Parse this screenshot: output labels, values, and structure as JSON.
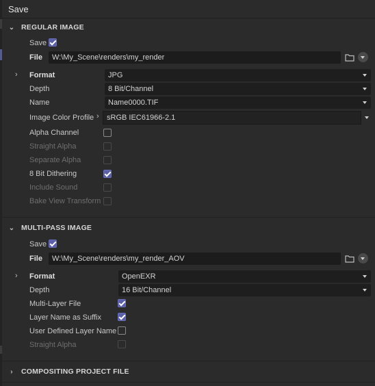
{
  "window": {
    "title": "Save"
  },
  "regular_image": {
    "header": "REGULAR IMAGE",
    "save_label": "Save",
    "save_checked": true,
    "file_label": "File",
    "file_value": "W:\\My_Scene\\renders\\my_render",
    "format_label": "Format",
    "format_value": "JPG",
    "depth_label": "Depth",
    "depth_value": "8 Bit/Channel",
    "name_label": "Name",
    "name_value": "Name0000.TIF",
    "profile_label": "Image Color Profile",
    "profile_value": "sRGB IEC61966-2.1",
    "options": [
      {
        "label": "Alpha Channel",
        "checked": false,
        "enabled": true
      },
      {
        "label": "Straight Alpha",
        "checked": false,
        "enabled": false
      },
      {
        "label": "Separate Alpha",
        "checked": false,
        "enabled": false
      },
      {
        "label": "8 Bit Dithering",
        "checked": true,
        "enabled": true
      },
      {
        "label": "Include Sound",
        "checked": false,
        "enabled": false
      },
      {
        "label": "Bake View Transform",
        "checked": false,
        "enabled": false
      }
    ]
  },
  "multi_pass": {
    "header": "MULTI-PASS IMAGE",
    "save_label": "Save",
    "save_checked": true,
    "file_label": "File",
    "file_value": "W:\\My_Scene\\renders\\my_render_AOV",
    "format_label": "Format",
    "format_value": "OpenEXR",
    "depth_label": "Depth",
    "depth_value": "16 Bit/Channel",
    "options": [
      {
        "label": "Multi-Layer File",
        "checked": true,
        "enabled": true
      },
      {
        "label": "Layer Name as Suffix",
        "checked": true,
        "enabled": true
      },
      {
        "label": "User Defined Layer Name",
        "checked": false,
        "enabled": true
      },
      {
        "label": "Straight Alpha",
        "checked": false,
        "enabled": false
      }
    ]
  },
  "compositing": {
    "header": "COMPOSITING PROJECT FILE"
  },
  "colors": {
    "accent": "#5b5fa8",
    "background": "#2b2b2b",
    "field": "#1c1c1c"
  }
}
